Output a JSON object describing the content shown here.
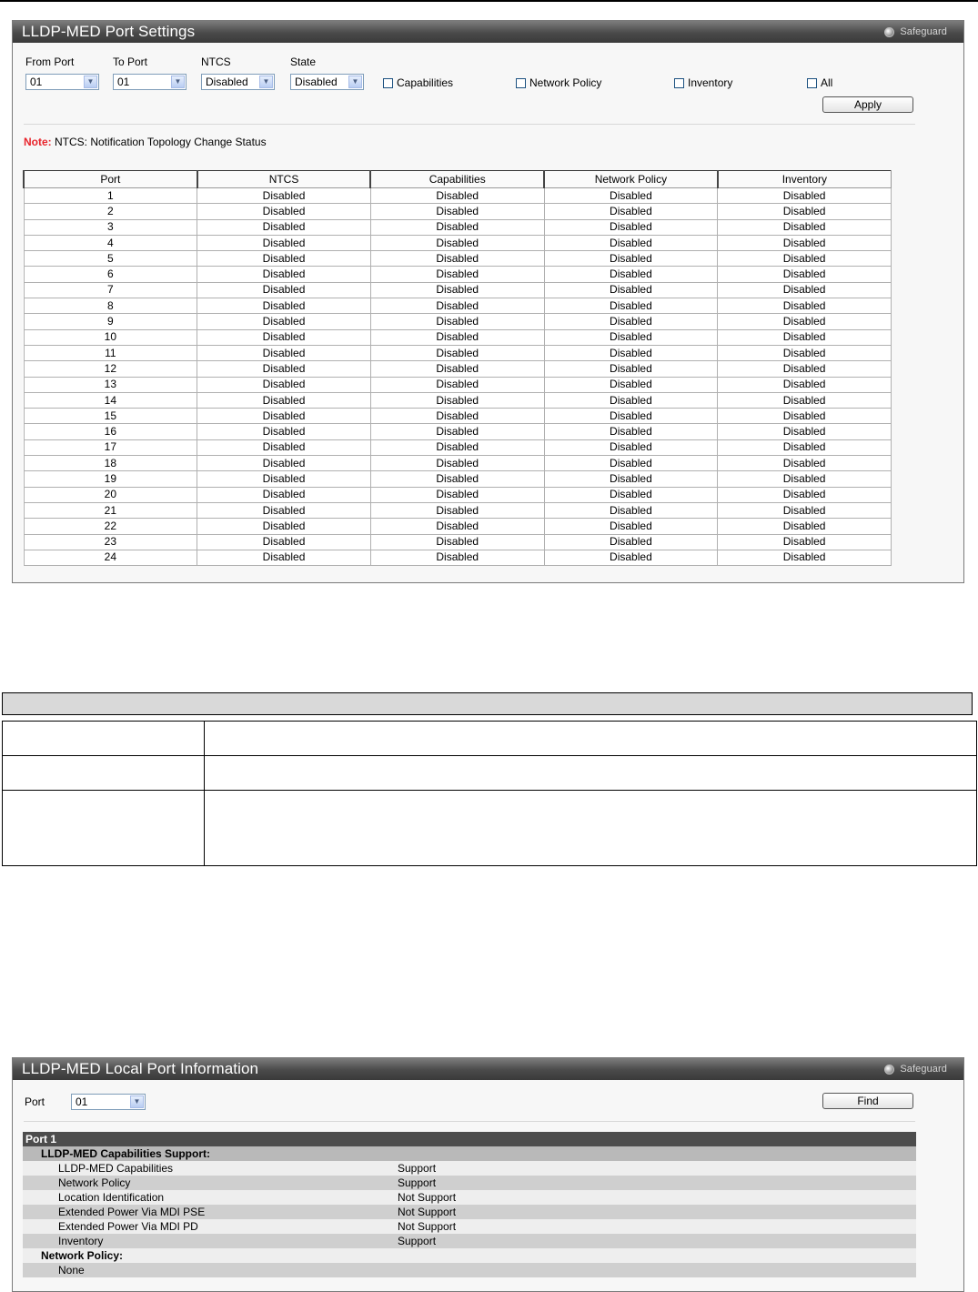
{
  "settings_panel": {
    "title": "LLDP-MED Port Settings",
    "safeguard": "Safeguard",
    "from_port_label": "From Port",
    "from_port_value": "01",
    "to_port_label": "To Port",
    "to_port_value": "01",
    "ntcs_label": "NTCS",
    "ntcs_value": "Disabled",
    "state_label": "State",
    "state_value": "Disabled",
    "chk_capabilities": "Capabilities",
    "chk_network_policy": "Network Policy",
    "chk_inventory": "Inventory",
    "chk_all": "All",
    "apply_label": "Apply",
    "note_prefix": "Note:",
    "note_text": " NTCS: Notification Topology Change Status",
    "table_headers": [
      "Port",
      "NTCS",
      "Capabilities",
      "Network Policy",
      "Inventory"
    ],
    "table_rows": [
      [
        "1",
        "Disabled",
        "Disabled",
        "Disabled",
        "Disabled"
      ],
      [
        "2",
        "Disabled",
        "Disabled",
        "Disabled",
        "Disabled"
      ],
      [
        "3",
        "Disabled",
        "Disabled",
        "Disabled",
        "Disabled"
      ],
      [
        "4",
        "Disabled",
        "Disabled",
        "Disabled",
        "Disabled"
      ],
      [
        "5",
        "Disabled",
        "Disabled",
        "Disabled",
        "Disabled"
      ],
      [
        "6",
        "Disabled",
        "Disabled",
        "Disabled",
        "Disabled"
      ],
      [
        "7",
        "Disabled",
        "Disabled",
        "Disabled",
        "Disabled"
      ],
      [
        "8",
        "Disabled",
        "Disabled",
        "Disabled",
        "Disabled"
      ],
      [
        "9",
        "Disabled",
        "Disabled",
        "Disabled",
        "Disabled"
      ],
      [
        "10",
        "Disabled",
        "Disabled",
        "Disabled",
        "Disabled"
      ],
      [
        "11",
        "Disabled",
        "Disabled",
        "Disabled",
        "Disabled"
      ],
      [
        "12",
        "Disabled",
        "Disabled",
        "Disabled",
        "Disabled"
      ],
      [
        "13",
        "Disabled",
        "Disabled",
        "Disabled",
        "Disabled"
      ],
      [
        "14",
        "Disabled",
        "Disabled",
        "Disabled",
        "Disabled"
      ],
      [
        "15",
        "Disabled",
        "Disabled",
        "Disabled",
        "Disabled"
      ],
      [
        "16",
        "Disabled",
        "Disabled",
        "Disabled",
        "Disabled"
      ],
      [
        "17",
        "Disabled",
        "Disabled",
        "Disabled",
        "Disabled"
      ],
      [
        "18",
        "Disabled",
        "Disabled",
        "Disabled",
        "Disabled"
      ],
      [
        "19",
        "Disabled",
        "Disabled",
        "Disabled",
        "Disabled"
      ],
      [
        "20",
        "Disabled",
        "Disabled",
        "Disabled",
        "Disabled"
      ],
      [
        "21",
        "Disabled",
        "Disabled",
        "Disabled",
        "Disabled"
      ],
      [
        "22",
        "Disabled",
        "Disabled",
        "Disabled",
        "Disabled"
      ],
      [
        "23",
        "Disabled",
        "Disabled",
        "Disabled",
        "Disabled"
      ],
      [
        "24",
        "Disabled",
        "Disabled",
        "Disabled",
        "Disabled"
      ]
    ]
  },
  "local_panel": {
    "title": "LLDP-MED Local Port Information",
    "safeguard": "Safeguard",
    "port_label": "Port",
    "port_value": "01",
    "find_label": "Find",
    "port_header": "Port 1",
    "caps_section": "LLDP-MED Capabilities Support:",
    "caps_rows": [
      {
        "k": "LLDP-MED Capabilities",
        "v": "Support"
      },
      {
        "k": "Network Policy",
        "v": "Support"
      },
      {
        "k": "Location Identification",
        "v": "Not Support"
      },
      {
        "k": "Extended Power Via MDI PSE",
        "v": "Not Support"
      },
      {
        "k": "Extended Power Via MDI PD",
        "v": "Not Support"
      },
      {
        "k": "Inventory",
        "v": "Support"
      }
    ],
    "policy_section": "Network Policy:",
    "policy_value": "None"
  },
  "colors": {
    "note_red": "#e8232b",
    "title_bar": "#4a4a4a",
    "select_border": "#7f9db9"
  }
}
